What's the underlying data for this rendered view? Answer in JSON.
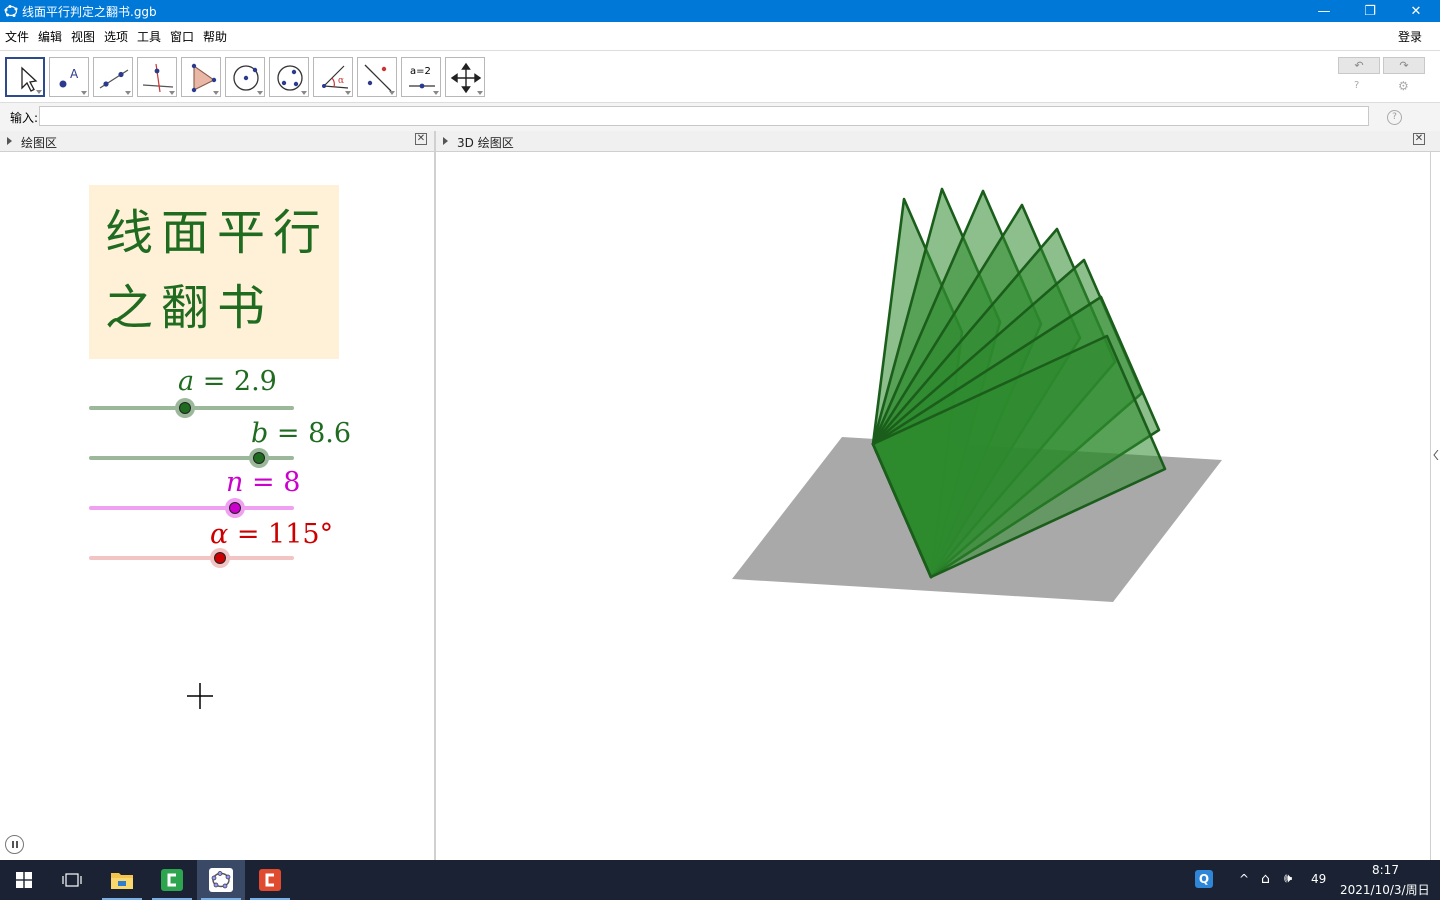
{
  "window": {
    "title": "线面平行判定之翻书.ggb",
    "minimize_glyph": "—",
    "restore_glyph": "❐",
    "close_glyph": "✕"
  },
  "menu": {
    "items": [
      "文件",
      "编辑",
      "视图",
      "选项",
      "工具",
      "窗口",
      "帮助"
    ],
    "login": "登录"
  },
  "toolbar": {
    "tools": [
      {
        "name": "move-tool-icon"
      },
      {
        "name": "point-tool-icon"
      },
      {
        "name": "line-tool-icon"
      },
      {
        "name": "perpendicular-line-tool-icon"
      },
      {
        "name": "polygon-tool-icon"
      },
      {
        "name": "circle-tool-icon"
      },
      {
        "name": "conic-tool-icon"
      },
      {
        "name": "angle-tool-icon"
      },
      {
        "name": "reflect-tool-icon"
      },
      {
        "name": "slider-tool-icon"
      },
      {
        "name": "move-graphics-view-tool-icon"
      }
    ],
    "slider_tool_text": "a=2",
    "undo_glyph": "↶",
    "redo_glyph": "↷",
    "help_glyph": "?",
    "settings_glyph": "⚙"
  },
  "input_bar": {
    "label": "输入:",
    "value": "",
    "help_glyph": "?"
  },
  "panels": {
    "graphics": {
      "title": "绘图区",
      "close_glyph": "✕"
    },
    "graphics3d": {
      "title": "3D 绘图区",
      "close_glyph": "✕"
    }
  },
  "graphics": {
    "title_text": {
      "line1": "线面平行",
      "line2": "之翻书",
      "text_color": "#1f6b1f",
      "box_color": "#fff0d8"
    },
    "sliders": [
      {
        "var": "a",
        "op": " = ",
        "value": "2.9",
        "color": "#1f6b1f",
        "track_color": "#9bb89b",
        "level": 0.47
      },
      {
        "var": "b",
        "op": " = ",
        "value": "8.6",
        "color": "#1f6b1f",
        "track_color": "#9bb89b",
        "level": 0.83
      },
      {
        "var": "n",
        "op": " = ",
        "value": "8",
        "color": "#cc00cc",
        "track_color": "#f0a0f0",
        "level": 0.71
      },
      {
        "var": "α",
        "op": " = ",
        "value": "115°",
        "color": "#cc0000",
        "track_color": "#f3c4c4",
        "level": 0.64
      }
    ]
  },
  "scene3d": {
    "plane_color": "#a9a9a9",
    "page_fill": "#2e8b2e",
    "page_stroke": "#1b5e1b"
  },
  "taskbar": {
    "apps": [
      {
        "name": "start-button"
      },
      {
        "name": "task-view-button"
      },
      {
        "name": "file-explorer-app"
      },
      {
        "name": "camtasia-app"
      },
      {
        "name": "geogebra-app"
      },
      {
        "name": "recorder-app"
      }
    ],
    "tray": {
      "tray_icon_q": "Q",
      "chevron": "^",
      "network_glyph": "⌂",
      "volume_glyph": "🕪",
      "ime": "49",
      "time": "8:17",
      "date": "2021/10/3/周日"
    }
  }
}
